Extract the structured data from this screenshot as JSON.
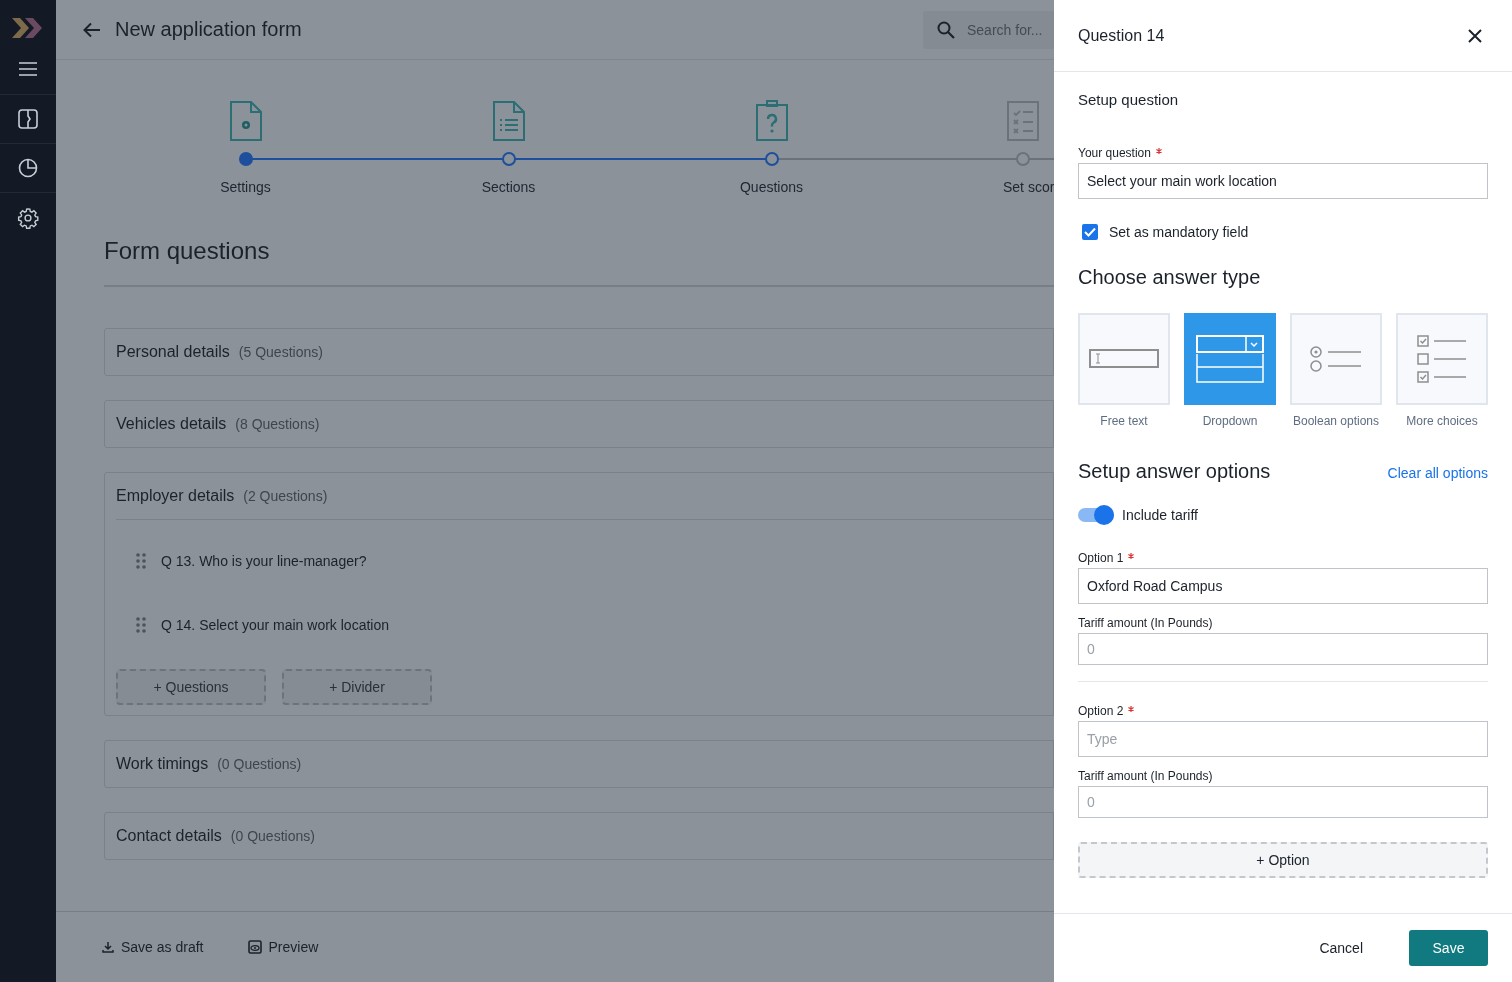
{
  "header": {
    "title": "New application form",
    "search": {
      "placeholder": "Search for..."
    }
  },
  "stepper": [
    {
      "label": "Settings",
      "kind": "settings",
      "reached": true,
      "current": true
    },
    {
      "label": "Sections",
      "kind": "sections",
      "reached": true,
      "current": false
    },
    {
      "label": "Questions",
      "kind": "questions",
      "reached": true,
      "current": false
    },
    {
      "label": "Set scor",
      "kind": "scoring",
      "reached": false,
      "current": false
    }
  ],
  "form": {
    "title": "Form questions",
    "sections": [
      {
        "title": "Personal details",
        "count": "(5 Questions)",
        "expanded": false
      },
      {
        "title": "Vehicles details",
        "count": "(8 Questions)",
        "expanded": false
      },
      {
        "title": "Employer details",
        "count": "(2 Questions)",
        "expanded": true,
        "questions": [
          "Q 13. Who is your line-manager?",
          "Q 14. Select your main work location"
        ],
        "add_buttons": [
          "+ Questions",
          "+ Divider"
        ]
      },
      {
        "title": "Work timings",
        "count": "(0 Questions)",
        "expanded": false
      },
      {
        "title": "Contact details",
        "count": "(0 Questions)",
        "expanded": false
      }
    ]
  },
  "footer": {
    "save_draft": "Save as draft",
    "preview": "Preview"
  },
  "drawer": {
    "title": "Question 14",
    "setup_title": "Setup question",
    "question_field": {
      "label": "Your question",
      "required": true,
      "value": "Select your main work location"
    },
    "mandatory": {
      "label": "Set as mandatory field",
      "checked": true
    },
    "answer_type_title": "Choose answer type",
    "answer_types": [
      {
        "label": "Free text",
        "kind": "free_text",
        "selected": false
      },
      {
        "label": "Dropdown",
        "kind": "dropdown",
        "selected": true
      },
      {
        "label": "Boolean options",
        "kind": "boolean",
        "selected": false
      },
      {
        "label": "More choices",
        "kind": "multiple",
        "selected": false
      }
    ],
    "options_title": "Setup answer options",
    "clear_link": "Clear all options",
    "tariff_toggle": {
      "label": "Include tariff",
      "on": true
    },
    "options": [
      {
        "label": "Option 1",
        "required": true,
        "value": "Oxford Road Campus",
        "tariff_label": "Tariff amount (In Pounds)",
        "tariff_placeholder": "0"
      },
      {
        "label": "Option 2",
        "required": true,
        "placeholder": "Type",
        "tariff_label": "Tariff amount (In Pounds)",
        "tariff_placeholder": "0"
      }
    ],
    "add_option": "+ Option",
    "cancel": "Cancel",
    "save": "Save"
  }
}
